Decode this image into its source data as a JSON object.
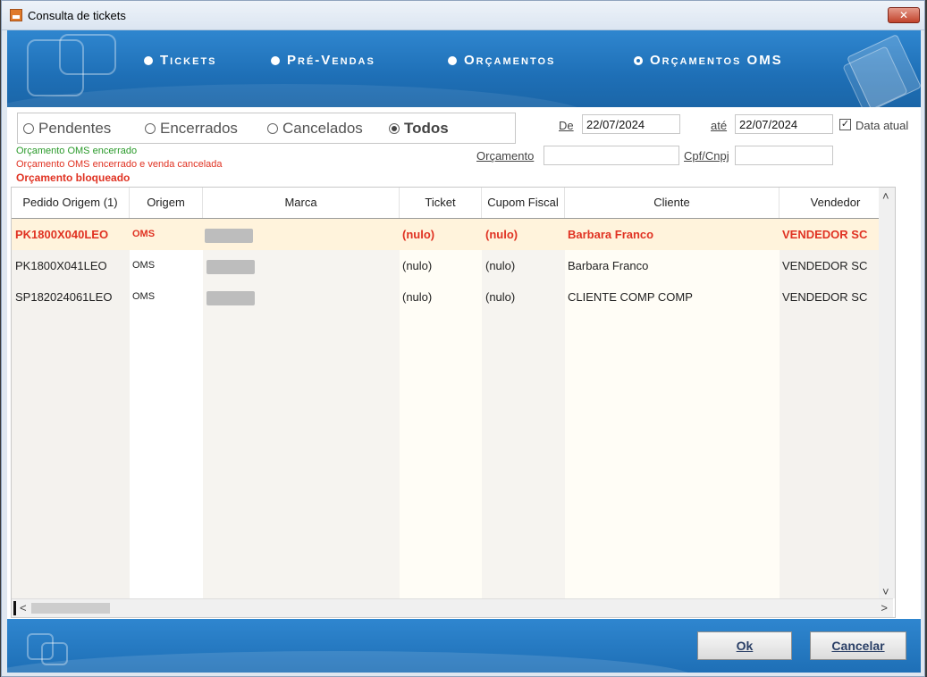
{
  "window": {
    "title": "Consulta de tickets",
    "close_glyph": "✕"
  },
  "top_options": [
    {
      "label": "Tickets",
      "selected": false
    },
    {
      "label": "Pré-Vendas",
      "selected": false
    },
    {
      "label": "Orçamentos",
      "selected": false
    },
    {
      "label": "Orçamentos OMS",
      "selected": true
    }
  ],
  "status_filter": [
    {
      "label": "Pendentes",
      "selected": false
    },
    {
      "label": "Encerrados",
      "selected": false
    },
    {
      "label": "Cancelados",
      "selected": false
    },
    {
      "label": "Todos",
      "selected": true
    }
  ],
  "legend": [
    {
      "text": "Orçamento OMS encerrado",
      "color": "#2a9a2a"
    },
    {
      "text": "Orçamento OMS encerrado e venda cancelada",
      "color": "#e03222"
    },
    {
      "text": "Orçamento bloqueado",
      "color": "#e03222"
    }
  ],
  "date_filter": {
    "from_label": "De",
    "from_value": "22/07/2024",
    "to_label": "até",
    "to_value": "22/07/2024",
    "current_date_label": "Data atual",
    "current_date_checked": true,
    "check_glyph": "✓"
  },
  "search": {
    "orcamento_label": "Orçamento",
    "orcamento_value": "",
    "cpf_label": "Cpf/Cnpj",
    "cpf_value": ""
  },
  "table": {
    "columns": [
      "Pedido Origem (1)",
      "Origem",
      "Marca",
      "Ticket",
      "Cupom Fiscal",
      "Cliente",
      "Vendedor"
    ],
    "rows": [
      {
        "pedido": "PK1800X040LEO",
        "origem": "OMS",
        "marca": "",
        "ticket": "(nulo)",
        "cupom": "(nulo)",
        "cliente": "Barbara Franco",
        "vendedor": "VENDEDOR SC",
        "style": "red"
      },
      {
        "pedido": "PK1800X041LEO",
        "origem": "OMS",
        "marca": "",
        "ticket": "(nulo)",
        "cupom": "(nulo)",
        "cliente": "Barbara Franco",
        "vendedor": "VENDEDOR SC",
        "style": "normal"
      },
      {
        "pedido": "SP182024061LEO",
        "origem": "OMS",
        "marca": "",
        "ticket": "(nulo)",
        "cupom": "(nulo)",
        "cliente": "CLIENTE COMP COMP",
        "vendedor": "VENDEDOR SC",
        "style": "normal"
      }
    ],
    "scroll_glyphs": {
      "up": "˄",
      "down": "˅",
      "left": "<",
      "right": ">"
    }
  },
  "buttons": {
    "ok": "Ok",
    "cancel": "Cancelar"
  }
}
